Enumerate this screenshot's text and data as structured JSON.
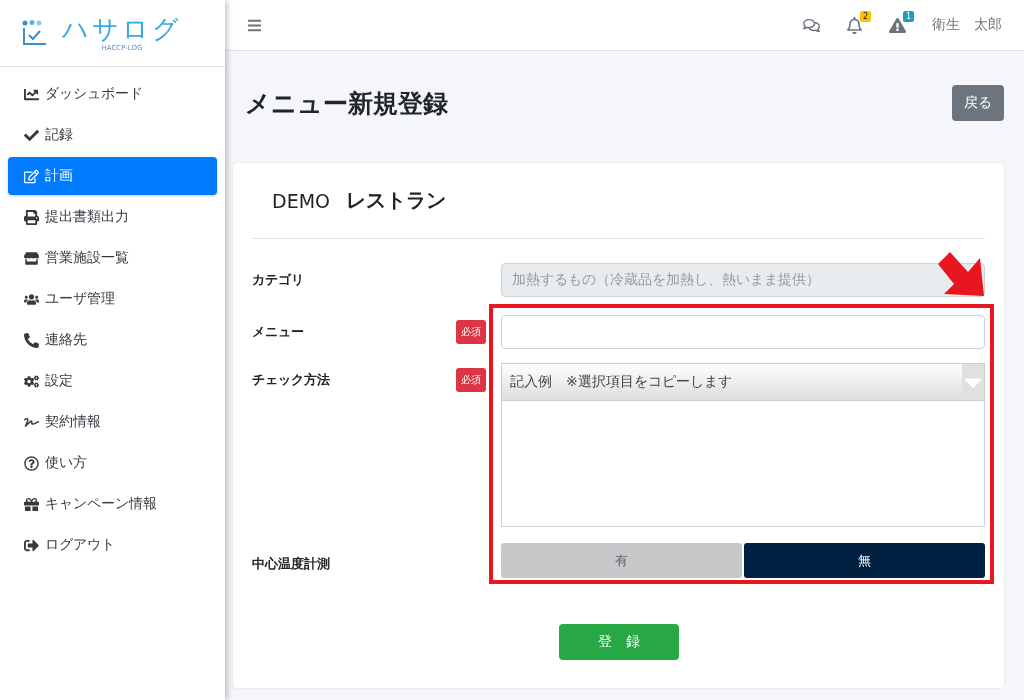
{
  "logo": {
    "name": "ハサログ",
    "subtitle": "HACCP-LOG"
  },
  "sidebar": {
    "items": [
      {
        "label": "ダッシュボード",
        "selected": false
      },
      {
        "label": "記録",
        "selected": false
      },
      {
        "label": "計画",
        "selected": true
      },
      {
        "label": "提出書類出力",
        "selected": false
      },
      {
        "label": "営業施設一覧",
        "selected": false
      },
      {
        "label": "ユーザ管理",
        "selected": false
      },
      {
        "label": "連絡先",
        "selected": false
      },
      {
        "label": "設定",
        "selected": false
      },
      {
        "label": "契約情報",
        "selected": false
      },
      {
        "label": "使い方",
        "selected": false
      },
      {
        "label": "キャンペーン情報",
        "selected": false
      },
      {
        "label": "ログアウト",
        "selected": false
      }
    ]
  },
  "topbar": {
    "notifications": [
      {
        "kind": "chat"
      },
      {
        "kind": "bell",
        "count": "2",
        "color": "#ffc107"
      },
      {
        "kind": "warning",
        "count": "1",
        "color": "#17a2b8"
      }
    ],
    "user": "衛生　太郎"
  },
  "page": {
    "title": "メニュー新規登録",
    "back_button": "戻る"
  },
  "card": {
    "store_prefix": "DEMO",
    "store_name": "レストラン",
    "fields": [
      {
        "kind": "readonly",
        "label": "カテゴリ",
        "value": "加熱するもの（冷蔵品を加熱し、熱いまま提供）"
      },
      {
        "kind": "text",
        "label": "メニュー",
        "required": "必須"
      },
      {
        "kind": "select_textarea",
        "label": "チェック方法",
        "required": "必須",
        "value": "記入例　※選択項目をコピーします"
      },
      {
        "kind": "toggle",
        "label": "中心温度計測",
        "options": [
          {
            "label": "有",
            "selected": false
          },
          {
            "label": "無",
            "selected": true
          }
        ]
      }
    ],
    "submit": "登　録"
  }
}
